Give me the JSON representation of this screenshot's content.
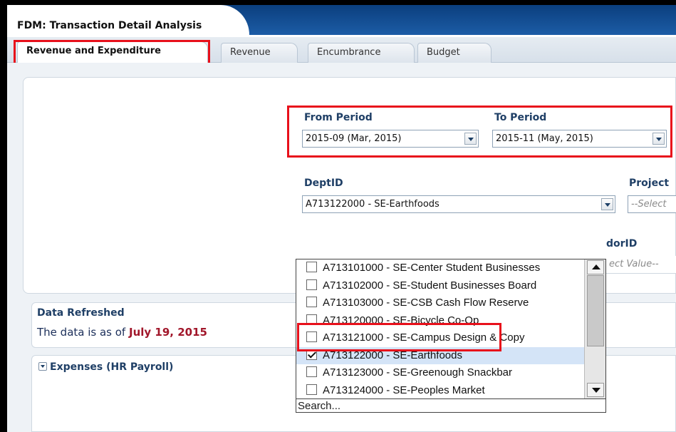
{
  "app": {
    "title": "FDM: Transaction Detail Analysis"
  },
  "tabs": [
    {
      "label": "Revenue and Expenditure",
      "active": true
    },
    {
      "label": "Revenue"
    },
    {
      "label": "Encumbrance"
    },
    {
      "label": "Budget"
    }
  ],
  "filters": {
    "from_period": {
      "label": "From Period",
      "value": "2015-09 (Mar, 2015)"
    },
    "to_period": {
      "label": "To Period",
      "value": "2015-11 (May, 2015)"
    },
    "dept": {
      "label": "DeptID",
      "value": "A713122000 - SE-Earthfoods"
    },
    "project": {
      "label": "Project",
      "placeholder": "--Select"
    },
    "vendor": {
      "label": "dorID",
      "placeholder": "ect Value--"
    }
  },
  "dept_dropdown": {
    "items": [
      {
        "label": "A713101000 - SE-Center Student Businesses",
        "checked": false
      },
      {
        "label": "A713102000 - SE-Student Businesses Board",
        "checked": false
      },
      {
        "label": "A713103000 - SE-CSB Cash Flow Reserve",
        "checked": false
      },
      {
        "label": "A713120000 - SE-Bicycle Co-Op",
        "checked": false
      },
      {
        "label": "A713121000 - SE-Campus Design & Copy",
        "checked": false
      },
      {
        "label": "A713122000 - SE-Earthfoods",
        "checked": true
      },
      {
        "label": "A713123000 - SE-Greenough Snackbar",
        "checked": false
      },
      {
        "label": "A713124000 - SE-Peoples Market",
        "checked": false
      }
    ],
    "search_label": "Search..."
  },
  "data_refreshed": {
    "heading": "Data Refreshed",
    "text": "The data is as of",
    "date": "July 19, 2015"
  },
  "expenses": {
    "header": "Expenses (HR Payroll)"
  },
  "colors": {
    "highlight": "#e8101b",
    "header_blue": "#0b3f7e",
    "date_red": "#a1162a"
  }
}
